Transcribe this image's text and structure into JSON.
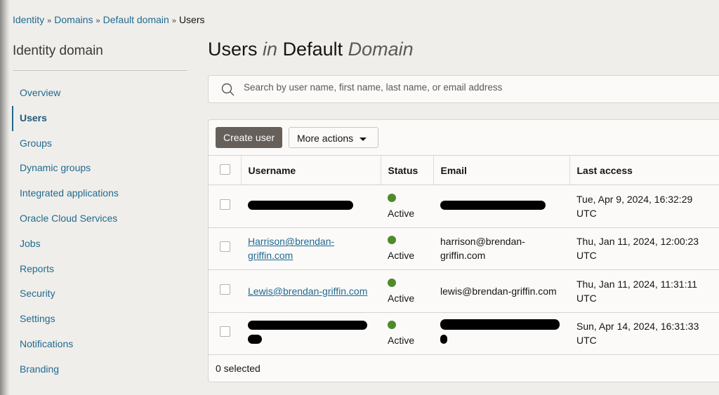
{
  "breadcrumb": [
    "Identity",
    "Domains",
    "Default domain",
    "Users"
  ],
  "sidebar": {
    "title": "Identity domain",
    "items": [
      "Overview",
      "Users",
      "Groups",
      "Dynamic groups",
      "Integrated applications",
      "Oracle Cloud Services",
      "Jobs",
      "Reports",
      "Security",
      "Settings",
      "Notifications",
      "Branding"
    ],
    "active": "Users"
  },
  "page": {
    "title_a": "Users",
    "title_b": "in",
    "title_c": "Default",
    "title_d": "Domain"
  },
  "search": {
    "placeholder": "Search by user name, first name, last name, or email address",
    "value": ""
  },
  "toolbar": {
    "create": "Create user",
    "more": "More actions"
  },
  "table": {
    "headers": [
      "Username",
      "Status",
      "Email",
      "Last access"
    ],
    "rows": [
      {
        "username": "",
        "status": "Active",
        "email": "",
        "last_access_1": "Tue, Apr 9, 2024, 16:32:29",
        "last_access_2": "UTC"
      },
      {
        "username": "Harrison@brendan-griffin.com",
        "status": "Active",
        "email": "harrison@brendan-griffin.com",
        "last_access_1": "Thu, Jan 11, 2024, 12:00:23",
        "last_access_2": "UTC"
      },
      {
        "username": "Lewis@brendan-griffin.com",
        "status": "Active",
        "email": "lewis@brendan-griffin.com",
        "last_access_1": "Thu, Jan 11, 2024, 11:31:11",
        "last_access_2": "UTC"
      },
      {
        "username": "",
        "status": "Active",
        "email": "",
        "last_access_1": "Sun, Apr 14, 2024, 16:31:33",
        "last_access_2": "UTC"
      }
    ]
  },
  "footer": {
    "selected": "0 selected"
  },
  "colors": {
    "link": "#1f6a8f",
    "primary_button": "#665f5a",
    "status_active": "#508a2b"
  }
}
